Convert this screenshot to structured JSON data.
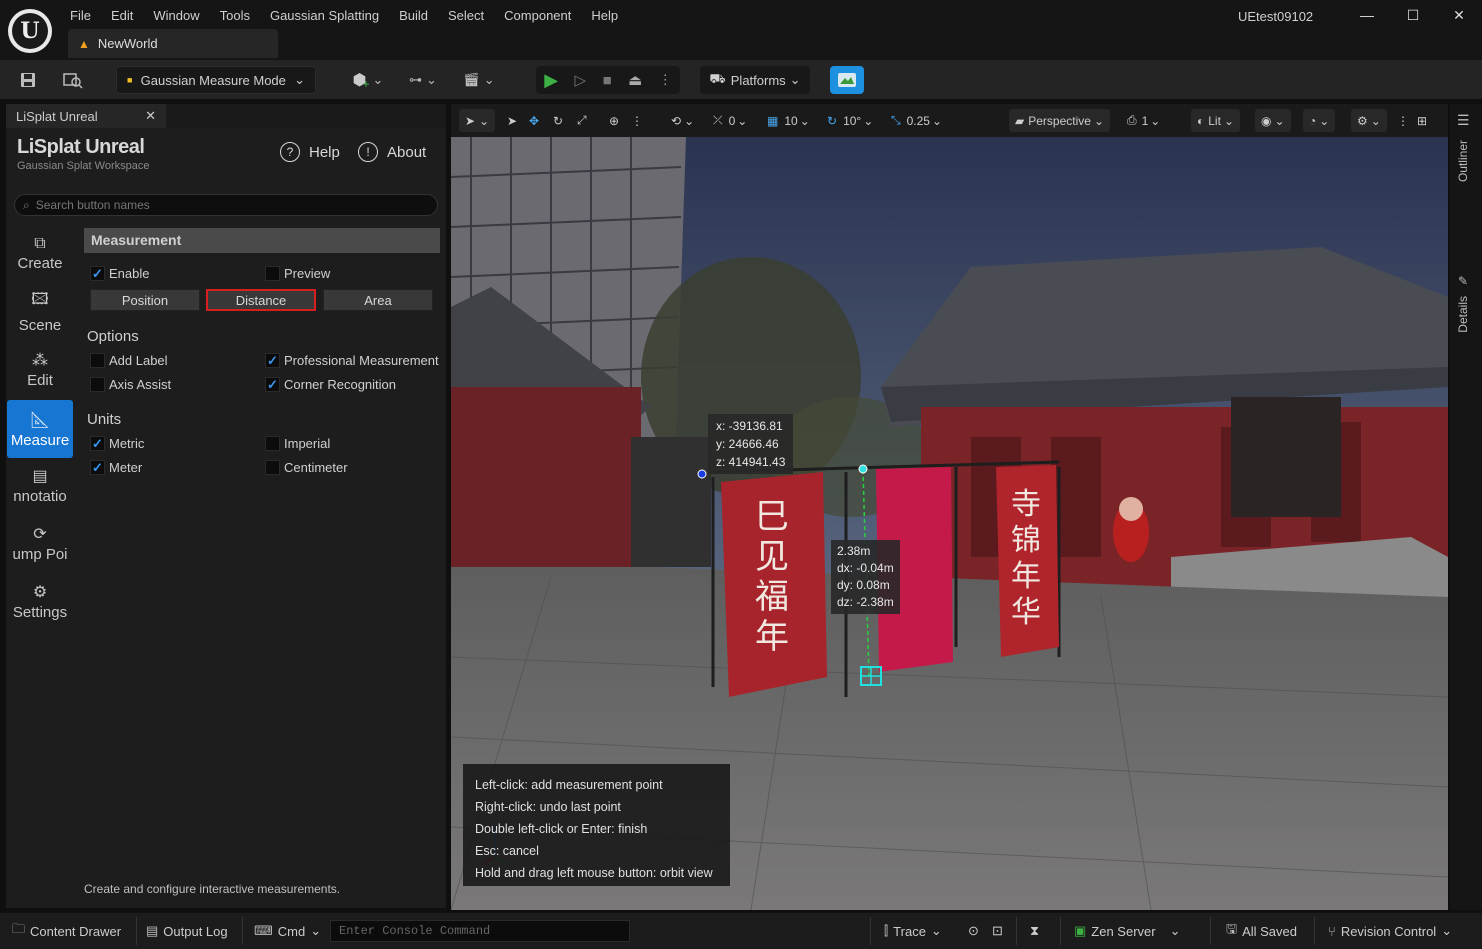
{
  "titlebar": {
    "menus": [
      "File",
      "Edit",
      "Window",
      "Tools",
      "Gaussian Splatting",
      "Build",
      "Select",
      "Component",
      "Help"
    ],
    "doc_tab": "NewWorld",
    "project": "UEtest09102",
    "window_controls": [
      "minimize",
      "maximize",
      "close"
    ]
  },
  "toolbar": {
    "mode": "Gaussian Measure Mode",
    "platforms": "Platforms"
  },
  "panel": {
    "tab": "LiSplat Unreal",
    "title": "LiSplat Unreal",
    "subtitle": "Gaussian Splat Workspace",
    "help": "Help",
    "about": "About",
    "search_placeholder": "Search button names",
    "sidebar": [
      {
        "label": "Create",
        "icon": "create-icon"
      },
      {
        "label": "Scene",
        "icon": "image-icon"
      },
      {
        "label": "Edit",
        "icon": "nodes-icon"
      },
      {
        "label": "Measure",
        "icon": "measure-icon"
      },
      {
        "label": "nnotatio",
        "icon": "annotation-icon"
      },
      {
        "label": "ump Poi",
        "icon": "jump-point-icon"
      },
      {
        "label": "Settings",
        "icon": "settings-icon"
      }
    ],
    "section": "Measurement",
    "enable": "Enable",
    "preview": "Preview",
    "modes": [
      "Position",
      "Distance",
      "Area"
    ],
    "selected_mode": "Distance",
    "options_header": "Options",
    "options": {
      "add_label": "Add Label",
      "professional": "Professional Measurement",
      "axis_assist": "Axis Assist",
      "corner": "Corner Recognition"
    },
    "units_header": "Units",
    "units": {
      "metric": "Metric",
      "imperial": "Imperial",
      "meter": "Meter",
      "centimeter": "Centimeter"
    },
    "footer": "Create and configure interactive measurements."
  },
  "viewport": {
    "snap_translate": "0",
    "grid": "10",
    "rot": "10°",
    "scale": "0.25",
    "view": "Perspective",
    "cam_speed": "1",
    "lit": "Lit",
    "coords": {
      "x": "x: -39136.81",
      "y": "y: 24666.46",
      "z": "z: 414941.43"
    },
    "distance": {
      "d": "2.38m",
      "dx": "dx: -0.04m",
      "dy": "dy: 0.08m",
      "dz": "dz: -2.38m"
    },
    "hints": [
      "Left-click: add measurement point",
      "Right-click: undo last point",
      "Double left-click or Enter: finish",
      "Esc: cancel",
      "Hold and drag left mouse button: orbit view"
    ],
    "banners": [
      "巳见福年",
      "寺锦年华"
    ]
  },
  "rightbar": {
    "outliner": "Outliner",
    "details": "Details"
  },
  "statusbar": {
    "content_drawer": "Content Drawer",
    "output_log": "Output Log",
    "cmd": "Cmd",
    "console_placeholder": "Enter Console Command",
    "trace": "Trace",
    "zen": "Zen Server",
    "saved": "All Saved",
    "revision": "Revision Control"
  }
}
